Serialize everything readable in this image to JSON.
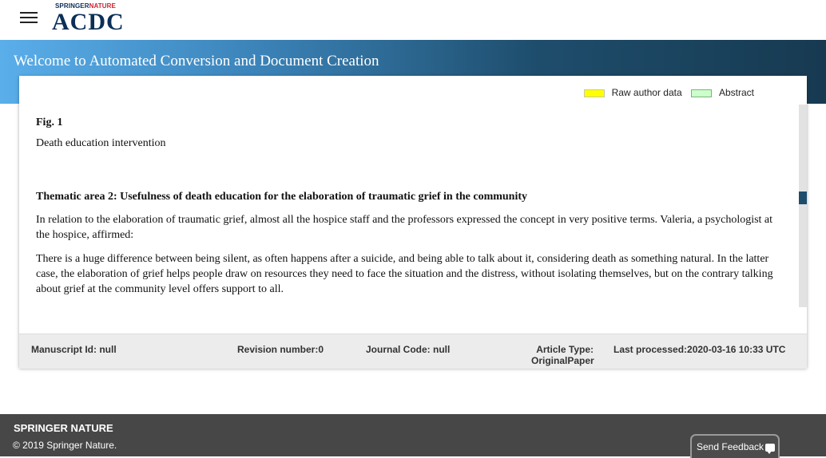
{
  "header": {
    "brand_small_prefix": "SPRINGER",
    "brand_small_suffix": "NATURE",
    "brand_big": "ACDC",
    "menu_icon": "hamburger-icon"
  },
  "hero": {
    "title": "Welcome to Automated Conversion and Document Creation"
  },
  "legend": [
    {
      "label": "Raw author data",
      "color": "#ffff00"
    },
    {
      "label": "Abstract",
      "color": "#ccffcc"
    }
  ],
  "content": {
    "fig_label": "Fig. 1",
    "fig_caption": "Death education intervention",
    "heading": "Thematic area 2: Usefulness of death education for the elaboration of traumatic grief in the community",
    "paragraph1": "In relation to the elaboration of traumatic grief, almost all the hospice staff and the professors expressed the concept in very positive terms. Valeria, a psychologist at the hospice, affirmed:",
    "paragraph2": "There is a huge difference between being silent, as often happens after a suicide, and being able to talk about it, considering death as something natural. In the latter case, the elaboration of grief helps people draw on resources they need to face the situation and the distress, without isolating themselves, but on the contrary talking about grief at the community level offers support to all."
  },
  "meta": {
    "manuscript": "Manuscript Id: null",
    "revision": "Revision number:0",
    "journal": "Journal Code: null",
    "article_type": "Article Type: OriginalPaper",
    "last_processed": "Last processed:2020-03-16 10:33 UTC"
  },
  "footer": {
    "brand": "SPRINGER NATURE",
    "copyright": "© 2019 Springer Nature.",
    "feedback_label": "Send Feedback",
    "feedback_icon": "chat-icon"
  }
}
